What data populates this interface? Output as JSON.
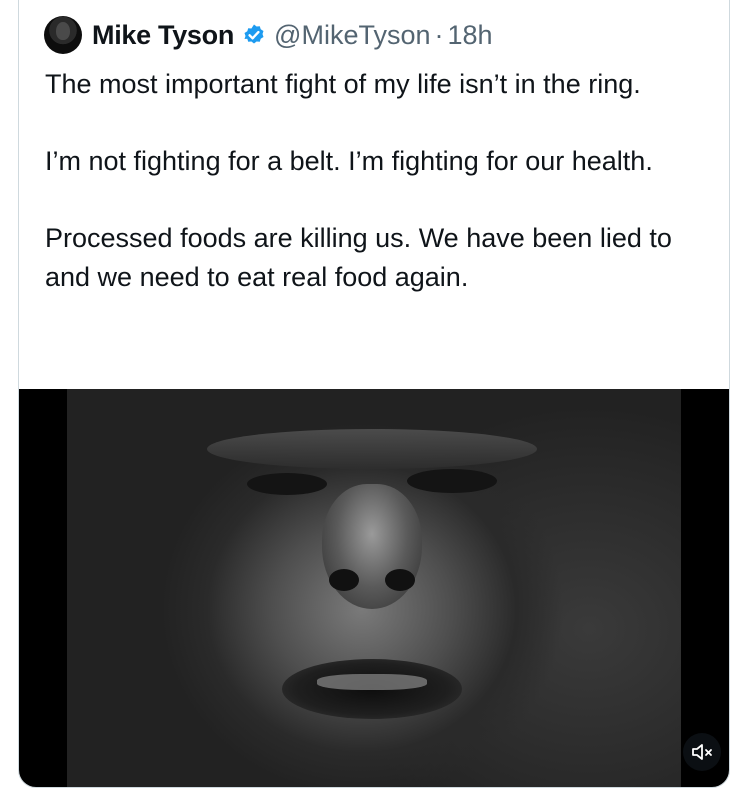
{
  "tweet": {
    "author": {
      "display_name": "Mike Tyson",
      "handle": "@MikeTyson",
      "verified": true
    },
    "separator": "·",
    "time": "18h",
    "paragraphs": [
      "The most important fight of my life isn’t in the ring.",
      "I’m not fighting for a belt. I’m fighting for our health.",
      "Processed foods are killing us. We have been lied to and we need to eat real food again."
    ],
    "media": {
      "type": "video",
      "muted_icon": "speaker-muted-icon"
    }
  },
  "colors": {
    "text_primary": "#0f1419",
    "text_secondary": "#536471",
    "verified_blue": "#1d9bf0",
    "border": "#cfd9de"
  }
}
